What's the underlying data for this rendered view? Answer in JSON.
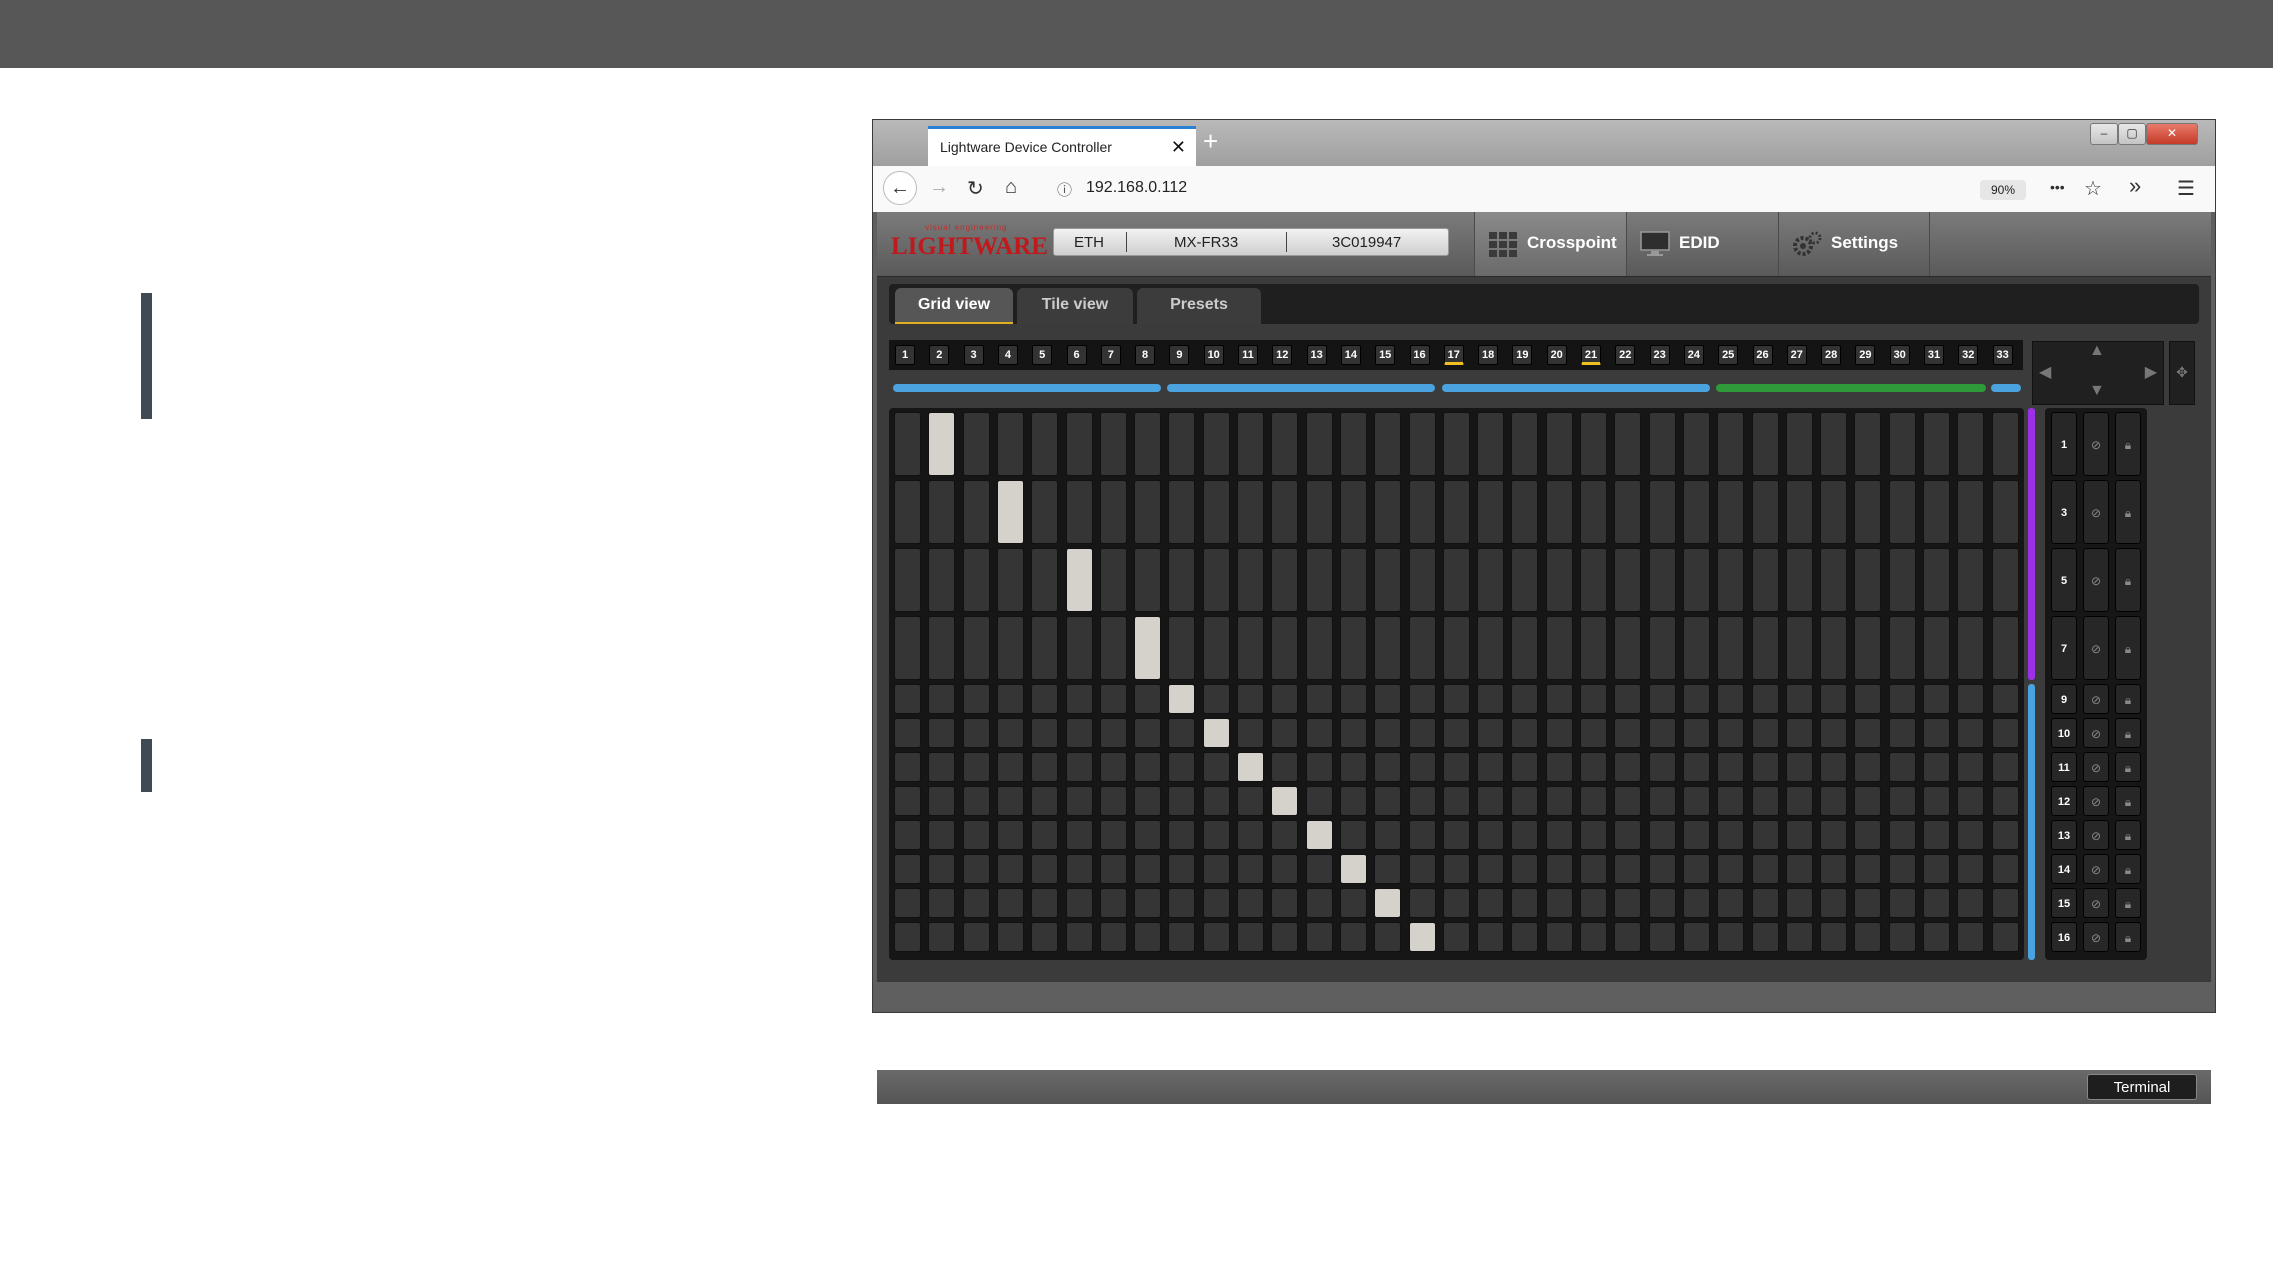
{
  "browser": {
    "tab_title": "Lightware Device Controller",
    "tab_close": "✕",
    "new_tab": "+",
    "url_info_icon": "ⓘ",
    "url": "192.168.0.112",
    "zoom": "90%",
    "page_actions": "•••",
    "bookmark_star": "☆",
    "overflow": "»",
    "menu": "☰",
    "back": "←",
    "forward": "→",
    "reload": "↻",
    "home": "⌂",
    "win_min": "–",
    "win_max": "▢",
    "win_close": "✕"
  },
  "app": {
    "logo_small": "visual engineering",
    "logo_main": "LIGHTWARE",
    "connection": "ETH",
    "model": "MX-FR33",
    "serial": "3C019947",
    "menu": {
      "crosspoint": "Crosspoint",
      "edid": "EDID",
      "settings": "Settings"
    },
    "subtabs": {
      "grid": "Grid view",
      "tile": "Tile view",
      "presets": "Presets"
    },
    "ports": [
      "1",
      "2",
      "3",
      "4",
      "5",
      "6",
      "7",
      "8",
      "9",
      "10",
      "11",
      "12",
      "13",
      "14",
      "15",
      "16",
      "17",
      "18",
      "19",
      "20",
      "21",
      "22",
      "23",
      "24",
      "25",
      "26",
      "27",
      "28",
      "29",
      "30",
      "31",
      "32",
      "33"
    ],
    "selected_ports": [
      "17",
      "21"
    ],
    "outputs": [
      "1",
      "3",
      "5",
      "7",
      "9",
      "10",
      "11",
      "12",
      "13",
      "14",
      "15",
      "16"
    ],
    "terminal": "Terminal",
    "colors": {
      "blue_bar": "#4aa3df",
      "green_bar": "#2f9a3a",
      "purple_bar": "#9b30e8",
      "active_tab_underline": "#e0b020"
    }
  }
}
